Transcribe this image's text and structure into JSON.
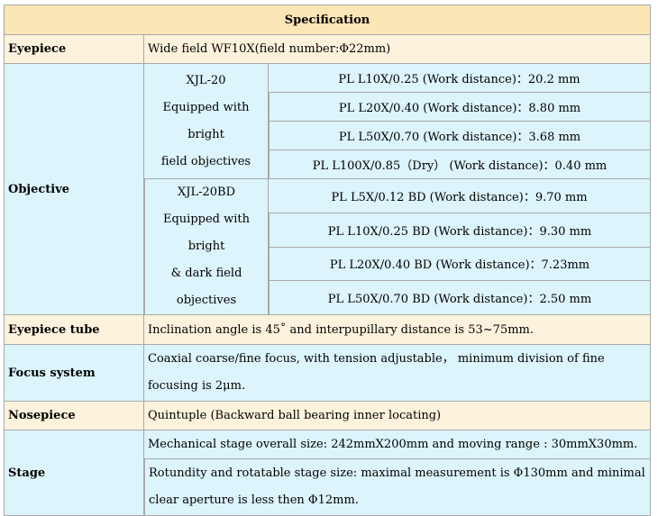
{
  "header": "Specification",
  "eyepiece": {
    "label": "Eyepiece",
    "value": "Wide field WF10X(field number:Φ22mm)"
  },
  "objective": {
    "label": "Objective",
    "groups": [
      {
        "name": "XJL-20",
        "line2": "Equipped with bright",
        "line3": "field objectives",
        "items": [
          "PL L10X/0.25  (Work distance)：20.2 mm",
          "PL L20X/0.40  (Work distance)：8.80 mm",
          "PL L50X/0.70  (Work distance)：3.68 mm",
          "PL L100X/0.85（Dry）  (Work distance)：0.40 mm"
        ]
      },
      {
        "name": "XJL-20BD",
        "line2": "Equipped with bright",
        "line3": "& dark field",
        "line4": "objectives",
        "items": [
          "PL L5X/0.12 BD  (Work distance)：9.70 mm",
          "PL L10X/0.25 BD  (Work distance)：9.30 mm",
          "PL L20X/0.40 BD  (Work distance)：7.23mm",
          "PL L50X/0.70 BD  (Work distance)：2.50 mm"
        ]
      }
    ]
  },
  "eyepiece_tube": {
    "label": "Eyepiece tube",
    "value": "Inclination angle is 45˚ and interpupillary distance is 53~75mm."
  },
  "focus_system": {
    "label": "Focus system",
    "value": "Coaxial coarse/fine focus, with tension adjustable， minimum division of fine focusing is 2μm."
  },
  "nosepiece": {
    "label": "Nosepiece",
    "value": "Quintuple (Backward ball bearing inner locating)"
  },
  "stage": {
    "label": "Stage",
    "line1": "Mechanical stage overall size: 242mmX200mm and moving range : 30mmX30mm.",
    "line2": "Rotundity and rotatable stage size: maximal measurement is Φ130mm and minimal clear aperture is less then Φ12mm."
  }
}
